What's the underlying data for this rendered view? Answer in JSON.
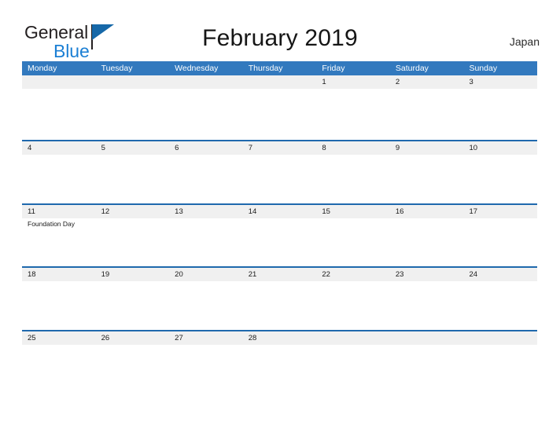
{
  "brand": {
    "name_line1": "General",
    "name_line2": "Blue",
    "logo_icon": "blue-flag-triangle-icon"
  },
  "header": {
    "title": "February 2019",
    "country": "Japan"
  },
  "calendar": {
    "month": "February",
    "year": "2019",
    "weekday_headers": [
      "Monday",
      "Tuesday",
      "Wednesday",
      "Thursday",
      "Friday",
      "Saturday",
      "Sunday"
    ],
    "colors": {
      "header_blue": "#3279be",
      "rule_blue": "#1f69ad",
      "date_band_gray": "#f0f0f0",
      "brand_blue": "#1b7fd4",
      "text_dark": "#1a1a1a"
    },
    "weeks": [
      {
        "days": [
          {
            "date": "",
            "empty": true,
            "events": []
          },
          {
            "date": "",
            "empty": true,
            "events": []
          },
          {
            "date": "",
            "empty": true,
            "events": []
          },
          {
            "date": "",
            "empty": true,
            "events": []
          },
          {
            "date": "1",
            "empty": false,
            "events": []
          },
          {
            "date": "2",
            "empty": false,
            "events": []
          },
          {
            "date": "3",
            "empty": false,
            "events": []
          }
        ]
      },
      {
        "days": [
          {
            "date": "4",
            "empty": false,
            "events": []
          },
          {
            "date": "5",
            "empty": false,
            "events": []
          },
          {
            "date": "6",
            "empty": false,
            "events": []
          },
          {
            "date": "7",
            "empty": false,
            "events": []
          },
          {
            "date": "8",
            "empty": false,
            "events": []
          },
          {
            "date": "9",
            "empty": false,
            "events": []
          },
          {
            "date": "10",
            "empty": false,
            "events": []
          }
        ]
      },
      {
        "days": [
          {
            "date": "11",
            "empty": false,
            "events": [
              "Foundation Day"
            ]
          },
          {
            "date": "12",
            "empty": false,
            "events": []
          },
          {
            "date": "13",
            "empty": false,
            "events": []
          },
          {
            "date": "14",
            "empty": false,
            "events": []
          },
          {
            "date": "15",
            "empty": false,
            "events": []
          },
          {
            "date": "16",
            "empty": false,
            "events": []
          },
          {
            "date": "17",
            "empty": false,
            "events": []
          }
        ]
      },
      {
        "days": [
          {
            "date": "18",
            "empty": false,
            "events": []
          },
          {
            "date": "19",
            "empty": false,
            "events": []
          },
          {
            "date": "20",
            "empty": false,
            "events": []
          },
          {
            "date": "21",
            "empty": false,
            "events": []
          },
          {
            "date": "22",
            "empty": false,
            "events": []
          },
          {
            "date": "23",
            "empty": false,
            "events": []
          },
          {
            "date": "24",
            "empty": false,
            "events": []
          }
        ]
      },
      {
        "days": [
          {
            "date": "25",
            "empty": false,
            "events": []
          },
          {
            "date": "26",
            "empty": false,
            "events": []
          },
          {
            "date": "27",
            "empty": false,
            "events": []
          },
          {
            "date": "28",
            "empty": false,
            "events": []
          },
          {
            "date": "",
            "empty": true,
            "events": []
          },
          {
            "date": "",
            "empty": true,
            "events": []
          },
          {
            "date": "",
            "empty": true,
            "events": []
          }
        ]
      }
    ]
  }
}
